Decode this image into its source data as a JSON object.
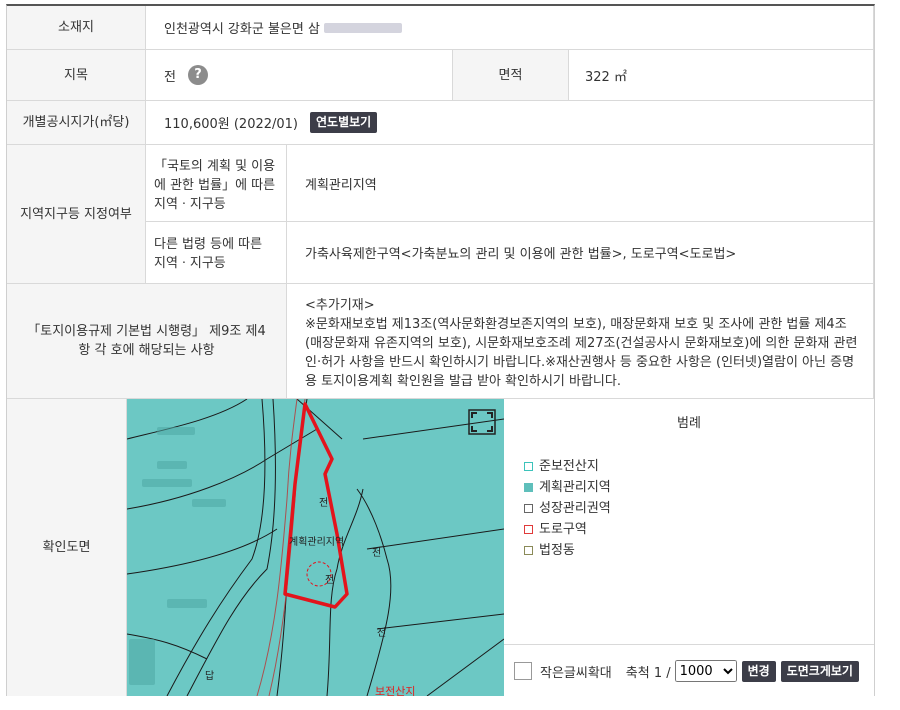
{
  "rows": {
    "location": {
      "label": "소재지",
      "value": "인천광역시 강화군 불은면 삼"
    },
    "land_category": {
      "label": "지목",
      "value": "전",
      "help": "?"
    },
    "area": {
      "label": "면적",
      "value": "322 ㎡"
    },
    "price": {
      "label": "개별공시지가(㎡당)",
      "value": "110,600원 (2022/01)",
      "button": "연도별보기"
    },
    "zone": {
      "label": "지역지구등 지정여부",
      "sub1_label": "「국토의 계획 및 이용에 관한 법률」에 따른 지역ㆍ지구등",
      "sub1_value": "계획관리지역",
      "sub2_label": "다른 법령 등에 따른 지역ㆍ지구등",
      "sub2_value": "가축사육제한구역<가축분뇨의 관리 및 이용에 관한 법률>, 도로구역<도로법>"
    },
    "regulation": {
      "label": "「토지이용규제 기본법 시행령」 제9조 제4항 각 호에 해당되는 사항",
      "value_title": "<추가기재>",
      "value_body": "※문화재보호법 제13조(역사문화환경보존지역의 보호), 매장문화재 보호 및 조사에 관한 법률 제4조(매장문화재 유존지역의 보호), 시문화재보호조례 제27조(건설공사시 문화재보호)에 의한 문화재 관련 인·허가 사항을 반드시 확인하시기 바랍니다.※재산권행사 등 중요한 사항은 (인터넷)열람이 아닌 증명용 토지이용계획 확인원을 발급 받아 확인하시기 바랍니다."
    },
    "map": {
      "label": "확인도면"
    }
  },
  "map_labels": {
    "zone_text": "계획관리지역",
    "lot1": "전",
    "lot2": "답",
    "lot3": "천",
    "lot4": "전",
    "lot5": "전",
    "lot6": "답",
    "bottom_red": "보전산지"
  },
  "legend": {
    "title": "범례",
    "items": [
      {
        "label": "준보전산지",
        "border": "#3cc3bb",
        "fill": "#ffffff"
      },
      {
        "label": "계획관리지역",
        "border": "#5fbfbb",
        "fill": "#5fbfbb"
      },
      {
        "label": "성장관리권역",
        "border": "#666666",
        "fill": "#ffffff"
      },
      {
        "label": "도로구역",
        "border": "#e03a3a",
        "fill": "#ffffff"
      },
      {
        "label": "법정동",
        "border": "#8a8a58",
        "fill": "#ffffff"
      }
    ]
  },
  "controls": {
    "enlarge_text": "작은글씨확대",
    "scale_label": "축척 1 /",
    "scale_value": "1000",
    "scale_options": [
      "1000"
    ],
    "change_button": "변경",
    "view_large_button": "도면크게보기"
  },
  "colors": {
    "map_bg": "#6cc8c4",
    "parcel": "#e3141c",
    "dark_button": "#3c3d48"
  }
}
